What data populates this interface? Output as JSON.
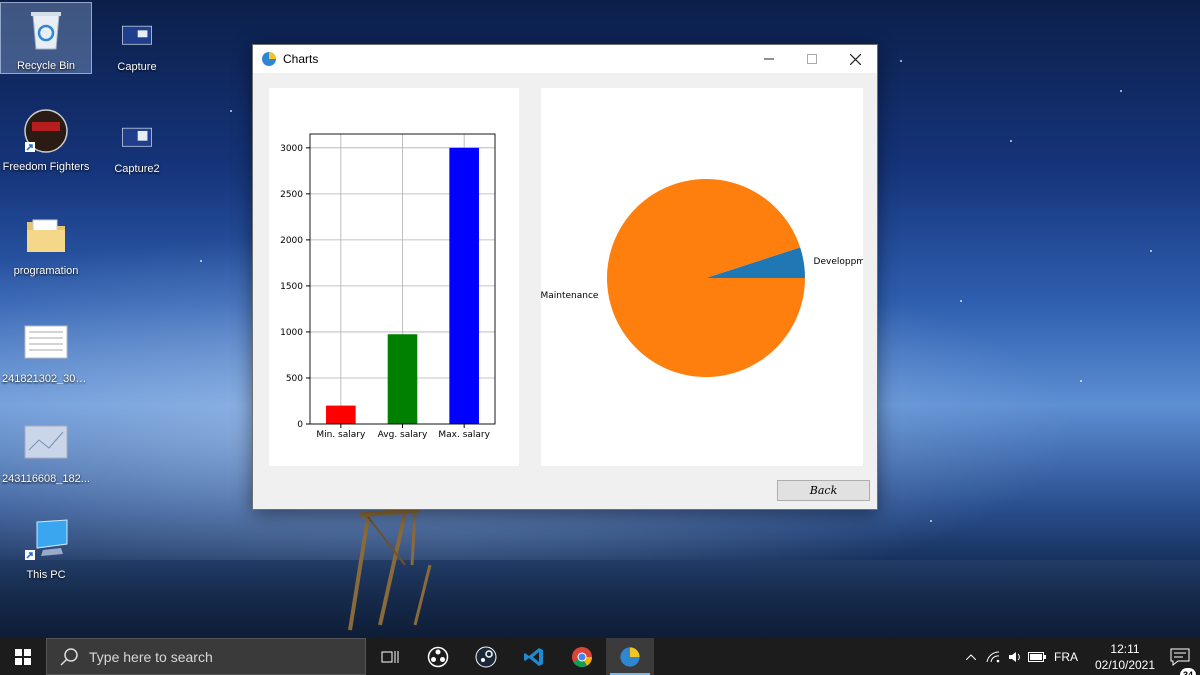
{
  "desktop": {
    "icons": [
      {
        "label": "Recycle Bin"
      },
      {
        "label": "Capture"
      },
      {
        "label": "Freedom Fighters"
      },
      {
        "label": "Capture2"
      },
      {
        "label": "programation"
      },
      {
        "label": "241821302_303..."
      },
      {
        "label": "243116608_182..."
      },
      {
        "label": "This PC"
      }
    ]
  },
  "window": {
    "title": "Charts",
    "minimize_icon": "minimize-icon",
    "maximize_icon": "maximize-icon",
    "close_icon": "close-icon",
    "back_label": "Back"
  },
  "chart_data": [
    {
      "type": "bar",
      "categories": [
        "Min. salary",
        "Avg. salary",
        "Max. salary"
      ],
      "values": [
        200,
        975,
        3000
      ],
      "colors": [
        "#ff0000",
        "#008000",
        "#0000ff"
      ],
      "ylim": [
        0,
        3150
      ],
      "yticks": [
        0,
        500,
        1000,
        1500,
        2000,
        2500,
        3000
      ],
      "grid": true
    },
    {
      "type": "pie",
      "labels": [
        "Developpm",
        "Maintenance"
      ],
      "values": [
        5,
        95
      ],
      "colors": [
        "#1f77b4",
        "#ff7f0e"
      ]
    }
  ],
  "taskbar": {
    "search_placeholder": "Type here to search",
    "language": "FRA",
    "time": "12:11",
    "date": "02/10/2021",
    "notification_count": "34"
  }
}
